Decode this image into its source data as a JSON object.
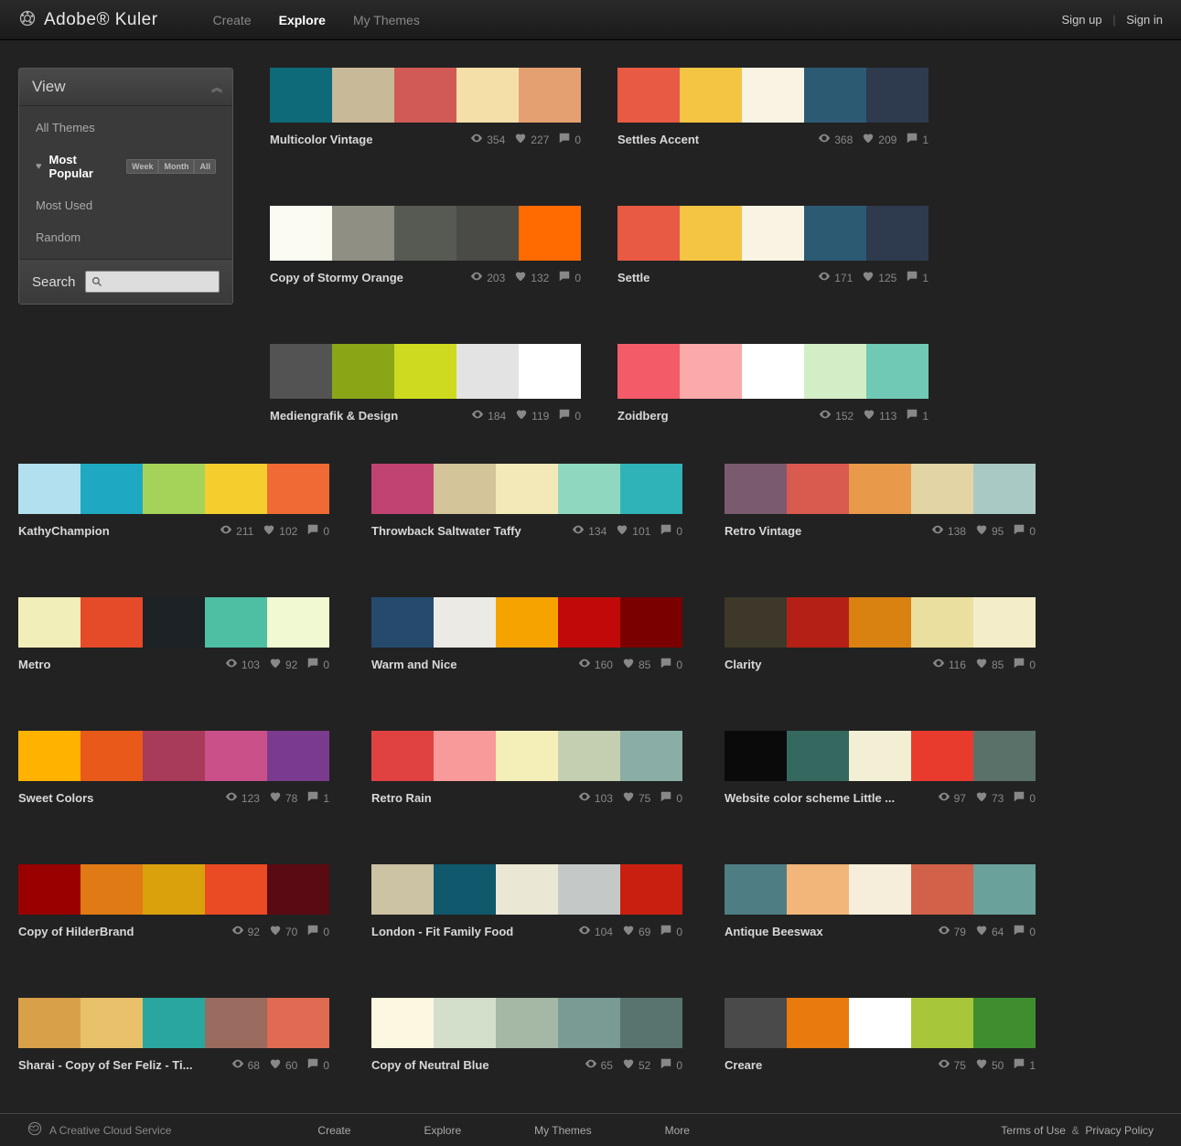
{
  "brand": "Adobe® Kuler",
  "nav": {
    "create": "Create",
    "explore": "Explore",
    "mythemes": "My Themes"
  },
  "auth": {
    "signup": "Sign up",
    "signin": "Sign in"
  },
  "sidebar": {
    "title": "View",
    "items": {
      "all": "All Themes",
      "popular": "Most Popular",
      "used": "Most Used",
      "random": "Random"
    },
    "pills": {
      "week": "Week",
      "month": "Month",
      "all": "All"
    },
    "search_label": "Search"
  },
  "top_themes": [
    {
      "name": "Multicolor Vintage",
      "views": 354,
      "likes": 227,
      "comments": 0,
      "colors": [
        "#0e6a78",
        "#c8b998",
        "#d15a55",
        "#f5dfa9",
        "#e5a072"
      ]
    },
    {
      "name": "Settles Accent",
      "views": 368,
      "likes": 209,
      "comments": 1,
      "colors": [
        "#e85a44",
        "#f4c443",
        "#f9f3e3",
        "#2c5a73",
        "#2e3b4e"
      ]
    },
    {
      "name": "Copy of Stormy Orange",
      "views": 203,
      "likes": 132,
      "comments": 0,
      "colors": [
        "#fbfbf1",
        "#8f8f83",
        "#565a52",
        "#4a4a46",
        "#ff6b00"
      ]
    },
    {
      "name": "Settle",
      "views": 171,
      "likes": 125,
      "comments": 1,
      "colors": [
        "#e85a44",
        "#f4c443",
        "#f9f3e3",
        "#2c5a73",
        "#2e3b4e"
      ]
    },
    {
      "name": "Mediengrafik & Design",
      "views": 184,
      "likes": 119,
      "comments": 0,
      "colors": [
        "#535353",
        "#8aa617",
        "#cdda1f",
        "#e3e3e3",
        "#ffffff"
      ]
    },
    {
      "name": "Zoidberg",
      "views": 152,
      "likes": 113,
      "comments": 1,
      "colors": [
        "#f45b69",
        "#f9aaa9",
        "#ffffff",
        "#d3edc7",
        "#6fc9b4"
      ]
    }
  ],
  "bottom_themes": [
    {
      "name": "KathyChampion",
      "views": 211,
      "likes": 102,
      "comments": 0,
      "colors": [
        "#b3e0ee",
        "#1ea8c1",
        "#a5d35a",
        "#f5ce2e",
        "#ef6a34"
      ]
    },
    {
      "name": "Throwback Saltwater Taffy",
      "views": 134,
      "likes": 101,
      "comments": 0,
      "colors": [
        "#c14371",
        "#d4c49a",
        "#f3e9b8",
        "#8fd8bf",
        "#2fb3b8"
      ]
    },
    {
      "name": "Retro Vintage",
      "views": 138,
      "likes": 95,
      "comments": 0,
      "colors": [
        "#7a5a6e",
        "#d95a4e",
        "#e89a4a",
        "#e3d4a6",
        "#a9c9c5"
      ]
    },
    {
      "name": "Metro",
      "views": 103,
      "likes": 92,
      "comments": 0,
      "colors": [
        "#f2eeba",
        "#e64b29",
        "#1c2226",
        "#4fbfa3",
        "#f1f9d3"
      ]
    },
    {
      "name": "Warm and Nice",
      "views": 160,
      "likes": 85,
      "comments": 0,
      "colors": [
        "#254a6e",
        "#eceae5",
        "#f6a300",
        "#c10909",
        "#7a0000"
      ]
    },
    {
      "name": "Clarity",
      "views": 116,
      "likes": 85,
      "comments": 0,
      "colors": [
        "#3d382a",
        "#b42016",
        "#d98212",
        "#eadf9e",
        "#f3edc9"
      ]
    },
    {
      "name": "Sweet Colors",
      "views": 123,
      "likes": 78,
      "comments": 1,
      "colors": [
        "#ffb300",
        "#e85a1a",
        "#a83a5a",
        "#c95089",
        "#7a3b8f"
      ]
    },
    {
      "name": "Retro Rain",
      "views": 103,
      "likes": 75,
      "comments": 0,
      "colors": [
        "#e04242",
        "#f79a99",
        "#f4efb8",
        "#c3cfb0",
        "#8aaea6"
      ]
    },
    {
      "name": "Website color scheme Little ...",
      "views": 97,
      "likes": 73,
      "comments": 0,
      "colors": [
        "#0a0a0a",
        "#35695f",
        "#f3efd4",
        "#e83b2e",
        "#5a716a"
      ]
    },
    {
      "name": "Copy of HilderBrand",
      "views": 92,
      "likes": 70,
      "comments": 0,
      "colors": [
        "#990000",
        "#e07a14",
        "#d9a10b",
        "#ea4a24",
        "#5a0a12"
      ]
    },
    {
      "name": "London - Fit Family Food",
      "views": 104,
      "likes": 69,
      "comments": 0,
      "colors": [
        "#ccc2a4",
        "#10586b",
        "#eae7d4",
        "#c4c8c7",
        "#c91f11"
      ]
    },
    {
      "name": "Antique Beeswax",
      "views": 79,
      "likes": 64,
      "comments": 0,
      "colors": [
        "#4e7e84",
        "#f2b67a",
        "#f6eeda",
        "#d16149",
        "#6aa19a"
      ]
    },
    {
      "name": "Sharai - Copy of Ser Feliz - Ti...",
      "views": 68,
      "likes": 60,
      "comments": 0,
      "colors": [
        "#d9a04a",
        "#e8c16a",
        "#2aa6a0",
        "#9a6b5f",
        "#e06a52"
      ]
    },
    {
      "name": "Copy of Neutral Blue",
      "views": 65,
      "likes": 52,
      "comments": 0,
      "colors": [
        "#fcf7e1",
        "#d3decb",
        "#a4b8a5",
        "#7a9a94",
        "#59746e"
      ]
    },
    {
      "name": "Creare",
      "views": 75,
      "likes": 50,
      "comments": 1,
      "colors": [
        "#4a4a4a",
        "#e87a0e",
        "#ffffff",
        "#a7c639",
        "#3e8e2f"
      ]
    }
  ],
  "footer": {
    "cc": "A Creative Cloud Service",
    "nav": {
      "create": "Create",
      "explore": "Explore",
      "mythemes": "My Themes",
      "more": "More"
    },
    "terms": "Terms of Use",
    "privacy": "Privacy Policy",
    "amp": "&"
  }
}
